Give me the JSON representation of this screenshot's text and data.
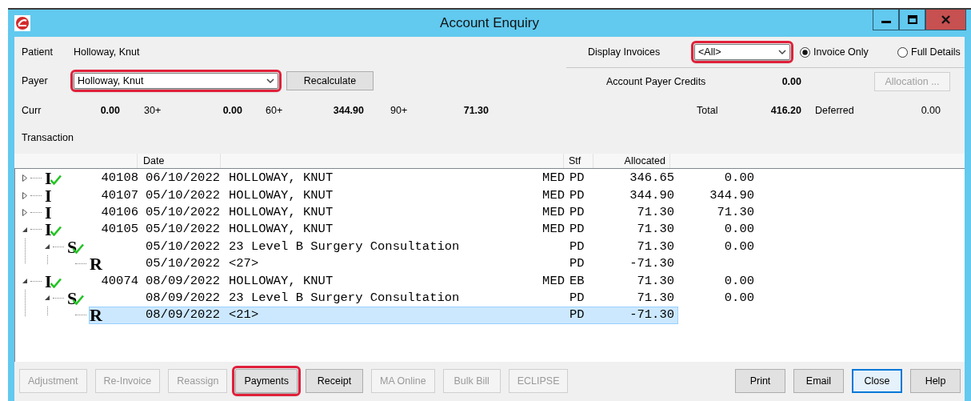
{
  "window": {
    "title": "Account Enquiry"
  },
  "patient": {
    "label": "Patient",
    "value": "Holloway, Knut"
  },
  "payer": {
    "label": "Payer",
    "value": "Holloway, Knut",
    "highlighted": true
  },
  "recalculate_button": {
    "label": "Recalculate"
  },
  "display_invoices": {
    "label": "Display Invoices",
    "value": "<All>",
    "highlighted": true
  },
  "view_options": [
    {
      "label": "Invoice Only",
      "selected": true
    },
    {
      "label": "Full Details",
      "selected": false
    }
  ],
  "account_payer_credits": {
    "label": "Account Payer Credits",
    "value": "0.00"
  },
  "allocation_button": {
    "label": "Allocation ...",
    "disabled": true
  },
  "aging": [
    {
      "label": "Curr",
      "value": "0.00"
    },
    {
      "label": "30+",
      "value": "0.00"
    },
    {
      "label": "60+",
      "value": "344.90"
    },
    {
      "label": "90+",
      "value": "71.30"
    }
  ],
  "total": {
    "label": "Total",
    "value": "416.20"
  },
  "deferred": {
    "label": "Deferred",
    "value": "0.00"
  },
  "transaction_label": "Transaction",
  "table": {
    "columns": {
      "date": "Date",
      "stf": "Stf",
      "allocated": "Allocated"
    },
    "rows": [
      {
        "letter": "I",
        "checked": true,
        "expanded": false,
        "selected": false,
        "column_1": "40108",
        "date": "06/10/2022",
        "description": "HOLLOWAY, KNUT",
        "column_4": "MED",
        "stf": "PD",
        "allocated": "346.65",
        "column_7": "0.00"
      },
      {
        "letter": "I",
        "checked": false,
        "expanded": false,
        "selected": false,
        "column_1": "40107",
        "date": "05/10/2022",
        "description": "HOLLOWAY, KNUT",
        "column_4": "MED",
        "stf": "PD",
        "allocated": "344.90",
        "column_7": "344.90"
      },
      {
        "letter": "I",
        "checked": false,
        "expanded": false,
        "selected": false,
        "column_1": "40106",
        "date": "05/10/2022",
        "description": "HOLLOWAY, KNUT",
        "column_4": "MED",
        "stf": "PD",
        "allocated": "71.30",
        "column_7": "71.30"
      },
      {
        "letter": "I",
        "checked": true,
        "expanded": true,
        "selected": false,
        "column_1": "40105",
        "date": "05/10/2022",
        "description": "HOLLOWAY, KNUT",
        "column_4": "MED",
        "stf": "PD",
        "allocated": "71.30",
        "column_7": "0.00",
        "children": [
          {
            "letter": "S",
            "checked": true,
            "expanded": true,
            "selected": false,
            "date": "05/10/2022",
            "description": "23 Level B Surgery Consultation",
            "stf": "PD",
            "allocated": "71.30",
            "column_7": "0.00",
            "children": [
              {
                "letter": "R",
                "checked": false,
                "selected": false,
                "date": "05/10/2022",
                "description": "<27>",
                "stf": "PD",
                "allocated": "-71.30"
              }
            ]
          }
        ]
      },
      {
        "letter": "I",
        "checked": true,
        "expanded": true,
        "selected": false,
        "column_1": "40074",
        "date": "08/09/2022",
        "description": "HOLLOWAY, KNUT",
        "column_4": "MED",
        "stf": "EB",
        "allocated": "71.30",
        "column_7": "0.00",
        "children": [
          {
            "letter": "S",
            "checked": true,
            "expanded": true,
            "selected": false,
            "date": "08/09/2022",
            "description": "23 Level B Surgery Consultation",
            "stf": "PD",
            "allocated": "71.30",
            "column_7": "0.00",
            "children": [
              {
                "letter": "R",
                "checked": false,
                "selected": true,
                "date": "08/09/2022",
                "description": "<21>",
                "stf": "PD",
                "allocated": "-71.30"
              }
            ]
          }
        ]
      }
    ]
  },
  "buttons_left": [
    {
      "label": "Adjustment",
      "disabled": true,
      "highlighted": false
    },
    {
      "label": "Re-Invoice",
      "disabled": true,
      "highlighted": false
    },
    {
      "label": "Reassign",
      "disabled": true,
      "highlighted": false
    },
    {
      "label": "Payments",
      "disabled": false,
      "highlighted": true
    },
    {
      "label": "Receipt",
      "disabled": false,
      "highlighted": false
    },
    {
      "label": "MA Online",
      "disabled": true,
      "highlighted": false
    },
    {
      "label": "Bulk Bill",
      "disabled": true,
      "highlighted": false
    },
    {
      "label": "ECLIPSE",
      "disabled": true,
      "highlighted": false
    }
  ],
  "buttons_right": [
    {
      "label": "Print",
      "default": false
    },
    {
      "label": "Email",
      "default": false
    },
    {
      "label": "Close",
      "default": true
    },
    {
      "label": "Help",
      "default": false
    }
  ]
}
